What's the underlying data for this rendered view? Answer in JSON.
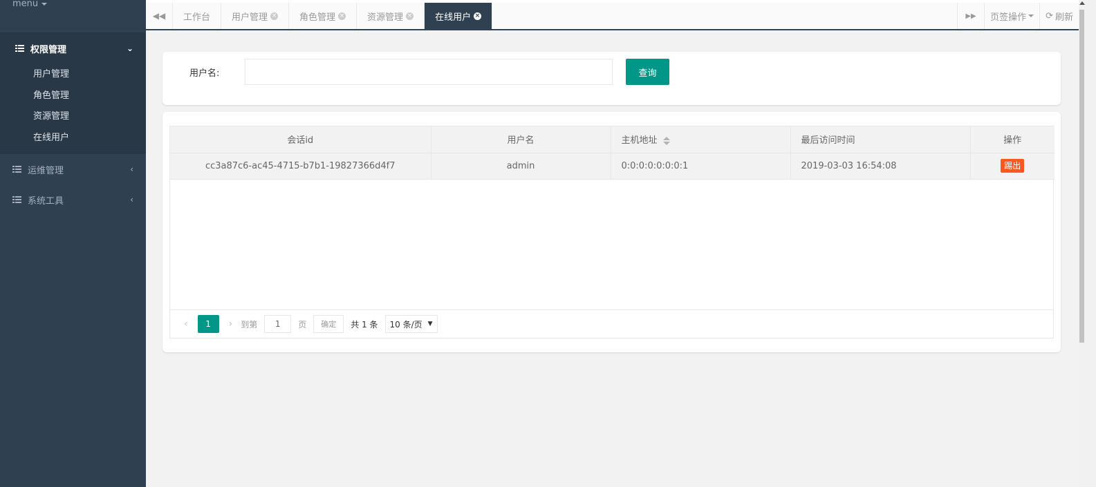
{
  "sidebar": {
    "menu_label": "menu",
    "groups": [
      {
        "label": "权限管理",
        "expanded": true,
        "items": [
          "用户管理",
          "角色管理",
          "资源管理",
          "在线用户"
        ]
      },
      {
        "label": "运维管理",
        "expanded": false
      },
      {
        "label": "系统工具",
        "expanded": false
      }
    ]
  },
  "tabs": {
    "items": [
      {
        "label": "工作台",
        "closable": false
      },
      {
        "label": "用户管理",
        "closable": true
      },
      {
        "label": "角色管理",
        "closable": true
      },
      {
        "label": "资源管理",
        "closable": true
      },
      {
        "label": "在线用户",
        "closable": true,
        "active": true
      }
    ],
    "page_ops_label": "页签操作",
    "refresh_label": "刷新"
  },
  "search": {
    "username_label": "用户名:",
    "username_value": "",
    "query_button": "查询"
  },
  "table": {
    "columns": [
      "会话id",
      "用户名",
      "主机地址",
      "最后访问时间",
      "操作"
    ],
    "rows": [
      {
        "session_id": "cc3a87c6-ac45-4715-b7b1-19827366d4f7",
        "username": "admin",
        "host": "0:0:0:0:0:0:0:1",
        "last_access": "2019-03-03 16:54:08",
        "action": "踢出"
      }
    ]
  },
  "pagination": {
    "current_page": "1",
    "goto_label": "到第",
    "goto_value": "1",
    "page_label": "页",
    "confirm_label": "确定",
    "total_label": "共 1 条",
    "page_size_label": "10 条/页"
  },
  "colors": {
    "sidebar_bg": "#2f4050",
    "primary": "#009688",
    "danger": "#ff5722"
  }
}
